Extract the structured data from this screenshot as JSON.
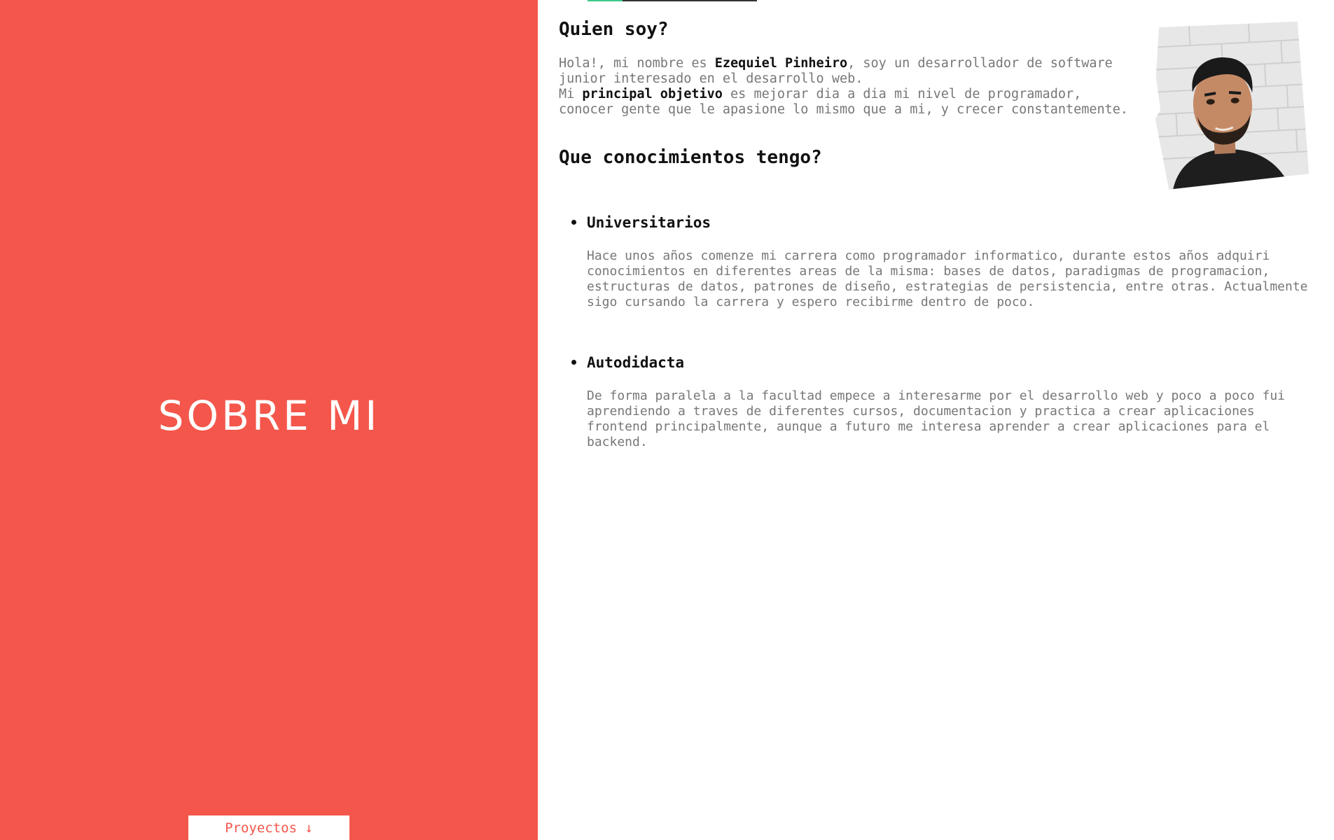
{
  "left": {
    "title": "SOBRE MI",
    "nav_button_label": "Proyectos ↓",
    "background_color": "#f4564b"
  },
  "about": {
    "heading": "Quien soy?",
    "intro_pre_name": "Hola!, mi nombre es ",
    "name": "Ezequiel Pinheiro",
    "intro_post_name": ", soy un desarrollador de software junior interesado en el desarrollo web.",
    "goal_pre": "Mi ",
    "goal_bold": "principal objetivo",
    "goal_post": " es mejorar dia a dia mi nivel de programador, conocer gente que le apasione lo mismo que a mi, y crecer constantemente."
  },
  "knowledge": {
    "heading": "Que conocimientos tengo?",
    "items": [
      {
        "title": "Universitarios",
        "description": "Hace unos años comenze mi carrera como programador informatico, durante estos años adquiri conocimientos en diferentes areas de la misma: bases de datos, paradigmas de programacion, estructuras de datos, patrones de diseño, estrategias de persistencia, entre otras. Actualmente sigo cursando la carrera y espero recibirme dentro de poco."
      },
      {
        "title": "Autodidacta",
        "description": "De forma paralela a la facultad empece a interesarme por el desarrollo web y poco a poco fui aprendiendo a traves de diferentes cursos, documentacion y practica a crear aplicaciones frontend principalmente, aunque a futuro me interesa aprender a crear aplicaciones para el backend."
      }
    ]
  },
  "accent_color": "#3cc88a"
}
